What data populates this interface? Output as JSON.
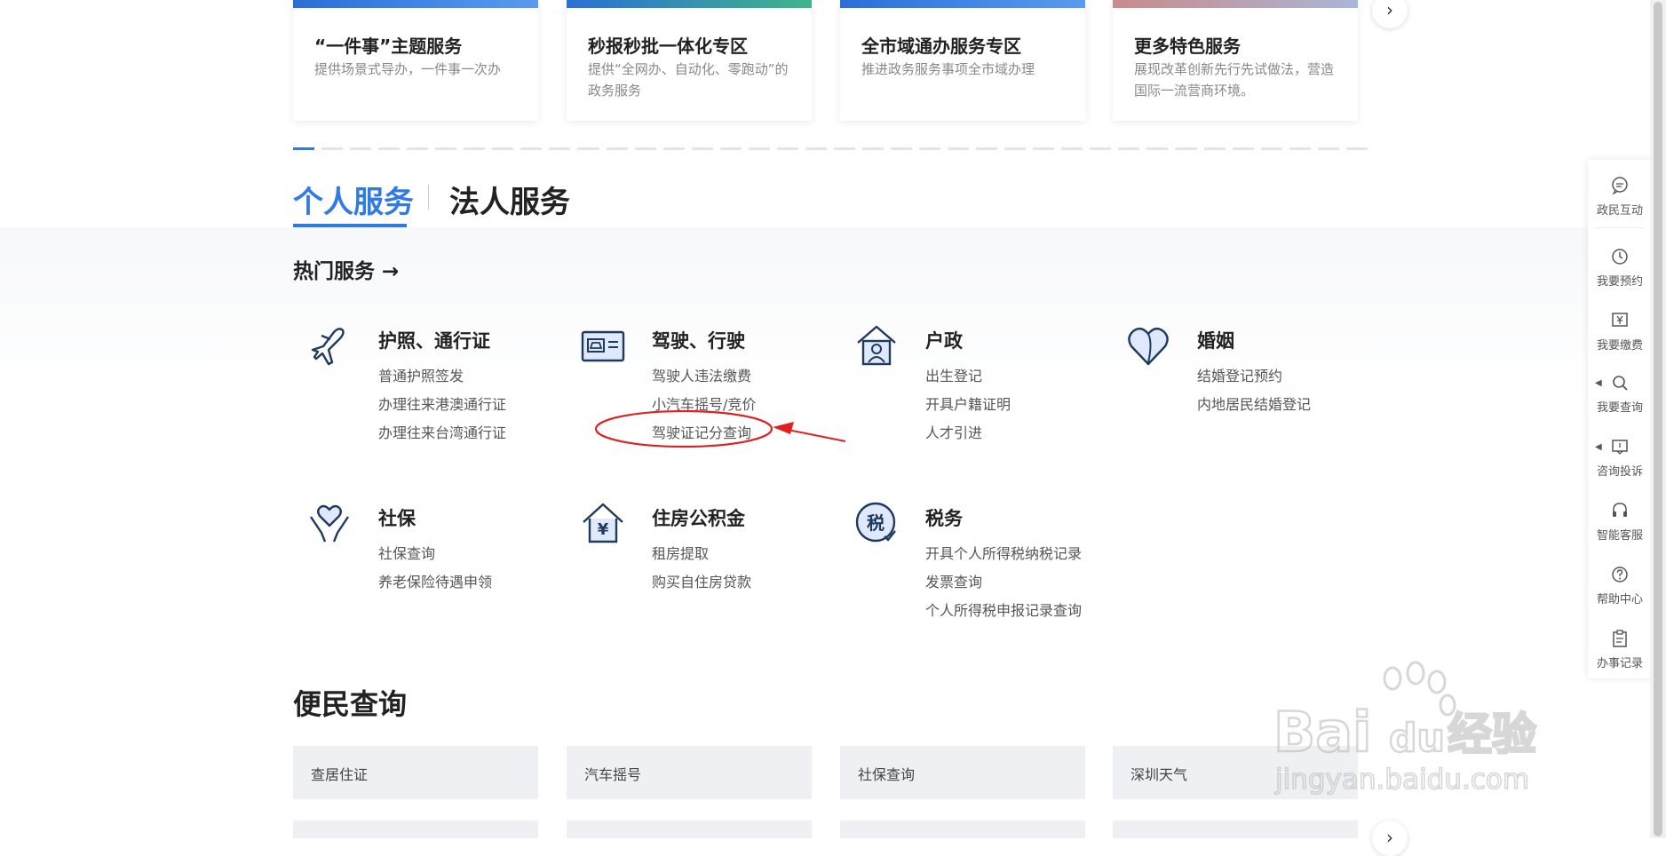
{
  "top_cards": [
    {
      "title": "“一件事”主题服务",
      "desc": "提供场景式导办，一件事一次办"
    },
    {
      "title": "秒报秒批一体化专区",
      "desc": "提供“全网办、自动化、零跑动”的政务服务"
    },
    {
      "title": "全市域通办服务专区",
      "desc": "推进政务服务事项全市域办理"
    },
    {
      "title": "更多特色服务",
      "desc": "展现改革创新先行先试做法，营造国际一流营商环境。"
    }
  ],
  "next_icon": "chevron-right-icon",
  "next_glyph": "›",
  "tabs": {
    "active": "个人服务",
    "inactive": "法人服务"
  },
  "hot_services": {
    "label": "热门服务",
    "arrow": "→"
  },
  "categories": [
    {
      "icon": "airplane-icon",
      "title": "护照、通行证",
      "links": [
        "普通护照签发",
        "办理往来港澳通行证",
        "办理往来台湾通行证"
      ]
    },
    {
      "icon": "license-card-icon",
      "title": "驾驶、行驶",
      "links": [
        "驾驶人违法缴费",
        "小汽车摇号/竞价",
        "驾驶证记分查询"
      ]
    },
    {
      "icon": "house-person-icon",
      "title": "户政",
      "links": [
        "出生登记",
        "开具户籍证明",
        "人才引进"
      ]
    },
    {
      "icon": "heart-icon",
      "title": "婚姻",
      "links": [
        "结婚登记预约",
        "内地居民结婚登记"
      ]
    },
    {
      "icon": "heart-hand-icon",
      "title": "社保",
      "links": [
        "社保查询",
        "养老保险待遇申领"
      ]
    },
    {
      "icon": "house-yuan-icon",
      "title": "住房公积金",
      "links": [
        "租房提取",
        "购买自住房贷款"
      ]
    },
    {
      "icon": "tax-icon",
      "title": "税务",
      "links": [
        "开具个人所得税纳税记录",
        "发票查询",
        "个人所得税申报记录查询"
      ]
    }
  ],
  "icon_glyphs": {
    "yuan": "¥",
    "tax": "税"
  },
  "convenience": {
    "title": "便民查询",
    "items": [
      "查居住证",
      "汽车摇号",
      "社保查询",
      "深圳天气"
    ]
  },
  "float_bar": [
    {
      "icon": "chat-icon",
      "label": "政民互动"
    },
    {
      "icon": "clock-icon",
      "label": "我要预约"
    },
    {
      "icon": "payment-icon",
      "label": "我要缴费"
    },
    {
      "icon": "search-icon",
      "label": "我要查询"
    },
    {
      "icon": "consult-icon",
      "label": "咨询投诉"
    },
    {
      "icon": "headset-icon",
      "label": "智能客服"
    },
    {
      "icon": "help-icon",
      "label": "帮助中心"
    },
    {
      "icon": "clipboard-icon",
      "label": "办事记录"
    }
  ],
  "watermark": {
    "brand": "Bai",
    "brand2": "du",
    "cn": "经验",
    "url": "jingyan.baidu.com"
  },
  "colors": {
    "accent": "#2f7ae5",
    "annotation": "#e02020"
  }
}
